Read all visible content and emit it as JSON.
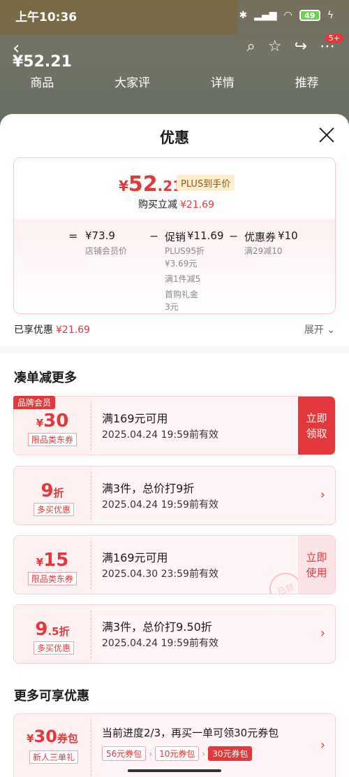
{
  "status_bar": {
    "time": "上午10:36",
    "battery": "49"
  },
  "background_page": {
    "price": "¥52.21",
    "tabs": [
      "商品",
      "大家评",
      "详情",
      "推荐"
    ],
    "cart_badge": "5+"
  },
  "sheet": {
    "title": "优惠",
    "price_card": {
      "yen": "¥",
      "price_int": "52",
      "price_dec": ".21",
      "plus_tag": "PLUS到手价",
      "buy_label": "购买立减",
      "buy_amount": "¥21.69",
      "calc": {
        "eq": "=",
        "member_price": "¥73.9",
        "member_label": "店铺会员价",
        "minus1": "−",
        "promo_label": "促销",
        "promo_value": "¥11.69",
        "promo_details": [
          "PLUS95折",
          "¥3.69元",
          "满1件减5",
          "首购礼金",
          "3元"
        ],
        "minus2": "−",
        "coupon_label": "优惠券",
        "coupon_value": "¥10",
        "coupon_detail": "满29减10"
      }
    },
    "enjoyed_label": "已享优惠",
    "enjoyed_amount": "¥21.69",
    "expand_label": "展开 ⌄",
    "section1_title": "凑单减更多",
    "coupons": [
      {
        "tag": "品牌会员",
        "amount_prefix": "¥",
        "amount": "30",
        "amount_suffix": "",
        "scope": "限品类东券",
        "condition": "满169元可用",
        "expire": "2025.04.24 19:59前有效",
        "action": "立即\n领取"
      },
      {
        "amount_prefix": "",
        "amount": "9",
        "amount_suffix": "折",
        "scope": "多买优惠",
        "condition": "满3件，总价打9折",
        "expire": "2025.04.24 19:59前有效"
      },
      {
        "amount_prefix": "¥",
        "amount": "15",
        "amount_suffix": "",
        "scope": "限品类东券",
        "condition": "满169元可用",
        "expire": "2025.04.30 23:59前有效",
        "action": "立即\n使用",
        "stamp": "已领"
      },
      {
        "amount_prefix": "",
        "amount": "9",
        "amount_mid": ".5",
        "amount_suffix": "折",
        "scope": "多买优惠",
        "condition": "满3件，总价打9.50折",
        "expire": "2025.04.24 19:59前有效"
      }
    ],
    "section2_title": "更多可享优惠",
    "pack": {
      "amount_prefix": "¥",
      "amount": "30",
      "amount_suffix": "券包",
      "scope": "新人三单礼",
      "progress": "当前进度2/3，再买一单可领30元券包",
      "steps": [
        "56元券包",
        "10元券包",
        "30元券包"
      ]
    }
  },
  "colors": {
    "accent": "#e4393c",
    "coupon_bg": "#fdf1f2"
  }
}
